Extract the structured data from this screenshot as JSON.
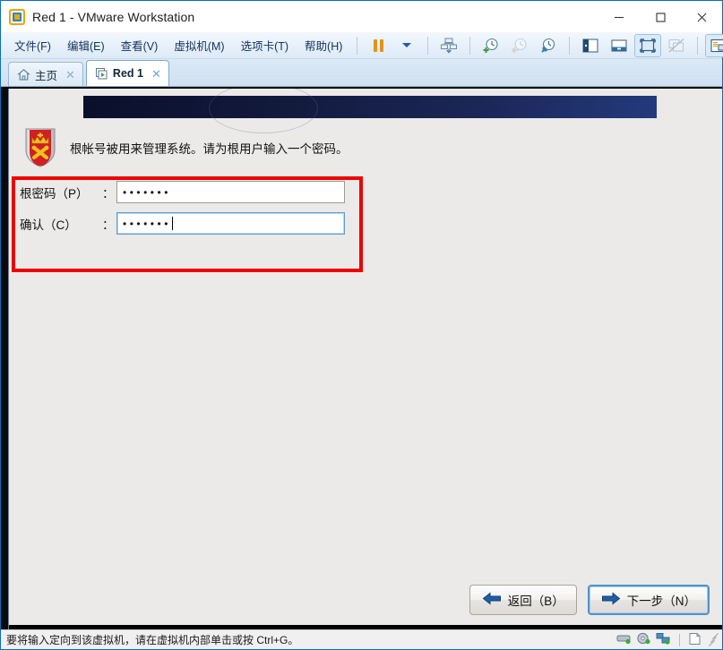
{
  "window": {
    "title": "Red 1 - VMware Workstation",
    "app_icon": "vmware-workstation-icon",
    "minimize_label": "—",
    "maximize_label": "□",
    "close_label": "✕"
  },
  "menubar": {
    "items": [
      {
        "label": "文件(F)",
        "name": "menu-file"
      },
      {
        "label": "编辑(E)",
        "name": "menu-edit"
      },
      {
        "label": "查看(V)",
        "name": "menu-view"
      },
      {
        "label": "虚拟机(M)",
        "name": "menu-vm"
      },
      {
        "label": "选项卡(T)",
        "name": "menu-tabs"
      },
      {
        "label": "帮助(H)",
        "name": "menu-help"
      }
    ]
  },
  "toolbar": {
    "icons": [
      "pause-icon",
      "power-dropdown-caret-icon",
      "send-ctrl-alt-del-icon",
      "take-snapshot-icon",
      "revert-snapshot-icon",
      "snapshot-manager-icon",
      "show-library-icon",
      "show-thumbnail-bar-icon",
      "full-screen-icon",
      "unity-mode-icon",
      "console-view-icon"
    ]
  },
  "tabs": [
    {
      "label": "主页",
      "icon": "home-icon",
      "close": "✕",
      "active": false
    },
    {
      "label": "Red 1",
      "icon": "vm-tab-icon",
      "close": "✕",
      "active": true
    }
  ],
  "installer": {
    "banner_title": "",
    "icon": "root-password-shield-icon",
    "description": "根帐号被用来管理系统。请为根用户输入一个密码。",
    "fields": [
      {
        "label": "根密码（P）",
        "colon": "：",
        "value": "•••••••",
        "focused": false,
        "name": "root-password-field"
      },
      {
        "label": "确认（C）",
        "colon": "：",
        "value": "•••••••",
        "focused": true,
        "name": "confirm-password-field"
      }
    ],
    "back_button": "返回（B）",
    "next_button": "下一步（N）",
    "highlight_color": "#ef0000",
    "banner_color": "#16204a",
    "background_color": "#ECEAE8"
  },
  "statusbar": {
    "message": "要将输入定向到该虚拟机，请在虚拟机内部单击或按 Ctrl+G。",
    "icons": [
      "hard-disk-icon",
      "cd-dvd-icon",
      "network-adapter-icon",
      "notes-icon"
    ]
  }
}
